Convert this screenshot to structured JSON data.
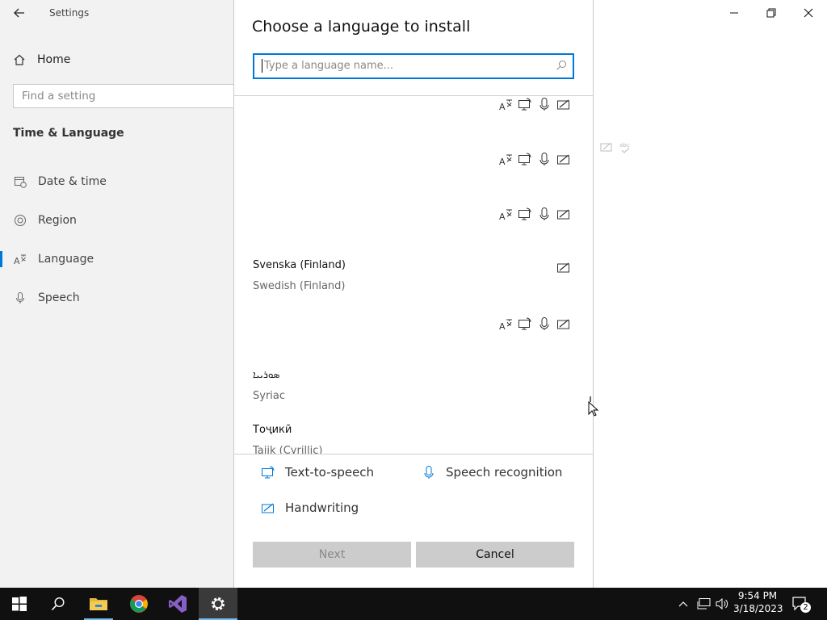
{
  "settings_window": {
    "title": "Settings",
    "home_label": "Home",
    "search_placeholder": "Find a setting",
    "section_title": "Time & Language",
    "nav_items": [
      {
        "label": "Date & time",
        "icon": "calendar-clock-icon"
      },
      {
        "label": "Region",
        "icon": "globe-icon"
      },
      {
        "label": "Language",
        "icon": "language-icon",
        "selected": true
      },
      {
        "label": "Speech",
        "icon": "microphone-icon"
      }
    ]
  },
  "dialog": {
    "title": "Choose a language to install",
    "search_placeholder": "Type a language name...",
    "languages": [
      {
        "name": "",
        "english": "",
        "features": [
          "display-language-icon",
          "text-to-speech-icon",
          "speech-recognition-icon",
          "handwriting-icon"
        ]
      },
      {
        "name": "",
        "english": "",
        "features": [
          "display-language-icon",
          "text-to-speech-icon",
          "speech-recognition-icon",
          "handwriting-icon"
        ]
      },
      {
        "name": "",
        "english": "",
        "features": [
          "display-language-icon",
          "text-to-speech-icon",
          "speech-recognition-icon",
          "handwriting-icon"
        ]
      },
      {
        "name": "Svenska (Finland)",
        "english": "Swedish (Finland)",
        "features": [
          "handwriting-icon"
        ]
      },
      {
        "name": "",
        "english": "",
        "features": [
          "display-language-icon",
          "text-to-speech-icon",
          "speech-recognition-icon",
          "handwriting-icon"
        ]
      },
      {
        "name": "ܣܘܪܝܝܐ",
        "english": "Syriac",
        "features": []
      },
      {
        "name": "Тоҷикӣ",
        "english": "Tajik (Cyrillic)",
        "features": []
      }
    ],
    "legend": {
      "text_to_speech": "Text-to-speech",
      "speech_recognition": "Speech recognition",
      "handwriting": "Handwriting"
    },
    "next_label": "Next",
    "cancel_label": "Cancel"
  },
  "taskbar": {
    "time": "9:54 PM",
    "date": "3/18/2023",
    "notification_count": "2",
    "apps": [
      "start-icon",
      "search-icon",
      "file-explorer-icon",
      "chrome-icon",
      "visual-studio-icon",
      "settings-icon"
    ]
  },
  "colors": {
    "accent": "#0078d7",
    "taskbar": "#101010",
    "sidebar": "#f2f2f2"
  }
}
